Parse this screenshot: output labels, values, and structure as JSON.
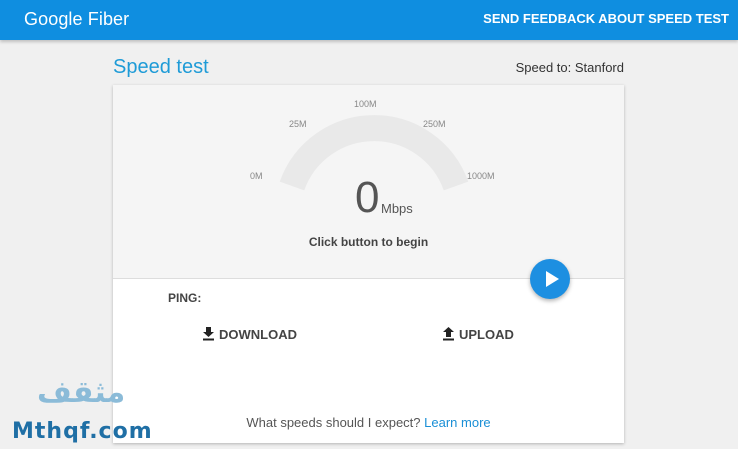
{
  "header": {
    "logo": "Google Fiber",
    "feedback": "SEND FEEDBACK ABOUT SPEED TEST"
  },
  "page": {
    "title": "Speed test",
    "speed_to": "Speed to: Stanford"
  },
  "gauge": {
    "ticks": [
      "0M",
      "25M",
      "100M",
      "250M",
      "1000M"
    ],
    "value": "0",
    "unit": "Mbps",
    "hint": "Click button to begin",
    "fill_fraction": 0
  },
  "results": {
    "ping_label": "PING:",
    "download_label": "DOWNLOAD",
    "upload_label": "UPLOAD"
  },
  "footer": {
    "question": "What speeds should I expect?",
    "learn_more": "Learn more"
  },
  "watermark": {
    "arabic": "مثقف",
    "latin": "Mthqf.com"
  },
  "colors": {
    "brand": "#0f8ee0",
    "title": "#1e9bd7",
    "button": "#1d8fe1"
  }
}
